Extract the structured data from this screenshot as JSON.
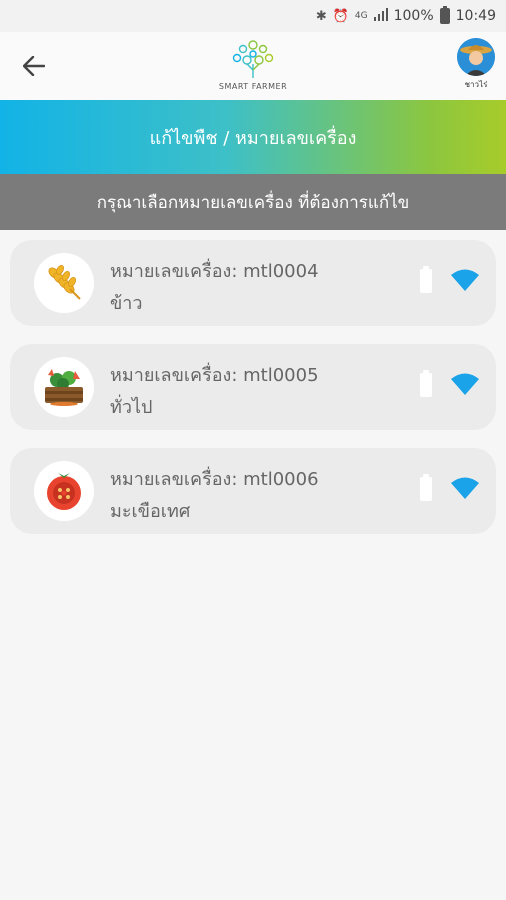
{
  "status_bar": {
    "battery_percent": "100%",
    "time": "10:49",
    "network": "4G"
  },
  "header": {
    "logo_text": "SMART FARMER",
    "avatar_label": "ชาวไร่",
    "accent_color": "#2a8fd6"
  },
  "title_band": {
    "title": "แก้ไขพืช / หมายเลขเครื่อง"
  },
  "sub_band": {
    "text": "กรุณาเลือกหมายเลขเครื่อง ที่ต้องการแก้ไข"
  },
  "devices": [
    {
      "label": "หมายเลขเครื่อง: mtl0004",
      "crop": "ข้าว",
      "icon": "wheat-icon"
    },
    {
      "label": "หมายเลขเครื่อง: mtl0005",
      "crop": "ทั่วไป",
      "icon": "vegetable-crate-icon"
    },
    {
      "label": "หมายเลขเครื่อง: mtl0006",
      "crop": "มะเขือเทศ",
      "icon": "tomato-icon"
    }
  ],
  "colors": {
    "wifi": "#1aa3e8",
    "gradient_start": "#12b3e6",
    "gradient_end": "#a7cc2a",
    "sub_band": "#7b7b7b"
  }
}
